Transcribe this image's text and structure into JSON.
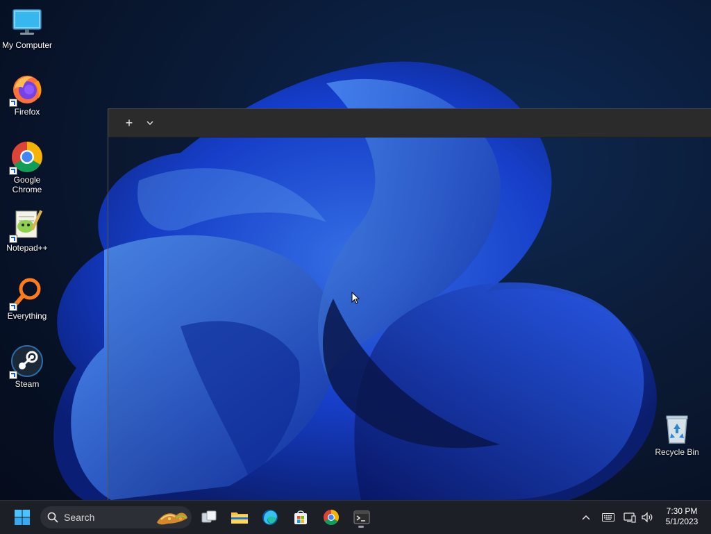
{
  "desktop": {
    "icons": [
      {
        "label": "My Computer",
        "icon": "monitor-icon"
      },
      {
        "label": "Firefox",
        "icon": "firefox-icon"
      },
      {
        "label": "Google Chrome",
        "icon": "chrome-icon"
      },
      {
        "label": "Notepad++",
        "icon": "notepadpp-icon"
      },
      {
        "label": "Everything",
        "icon": "everything-icon"
      },
      {
        "label": "Steam",
        "icon": "steam-icon"
      },
      {
        "label": "Recycle Bin",
        "icon": "recycle-bin-icon"
      }
    ]
  },
  "terminal": {
    "new_tab_glyph": "+",
    "dropdown_glyph": "⌄"
  },
  "taskbar": {
    "search_label": "Search",
    "clock_time": "7:30 PM",
    "clock_date": "5/1/2023",
    "pinned": [
      "start-icon",
      "task-view-icon",
      "file-explorer-icon",
      "edge-icon",
      "store-icon",
      "chrome-icon",
      "terminal-icon"
    ]
  },
  "colors": {
    "wallpaper_bloom": "#1a4cff",
    "taskbar_bg": "#1c1f26",
    "terminal_titlebar": "#2b2b2b"
  }
}
